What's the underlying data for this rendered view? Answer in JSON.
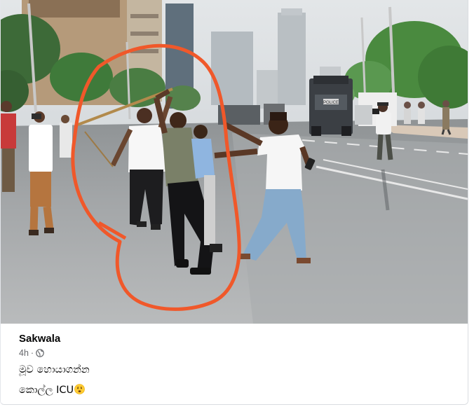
{
  "post": {
    "page_name": "Sakwala",
    "time_ago": "4h",
    "separator": "·",
    "privacy_icon": "globe-icon",
    "text_lines": [
      "මූව හොයාගන්න",
      "කොල්ල ICU"
    ],
    "emoji": "sad-face-emoji"
  },
  "photo": {
    "signs": [
      "POLICE"
    ],
    "highlight_color": "#f0582a"
  },
  "colors": {
    "name": "#050505",
    "meta": "#65676b",
    "border": "#dadde1",
    "annotation": "#f0582a"
  }
}
